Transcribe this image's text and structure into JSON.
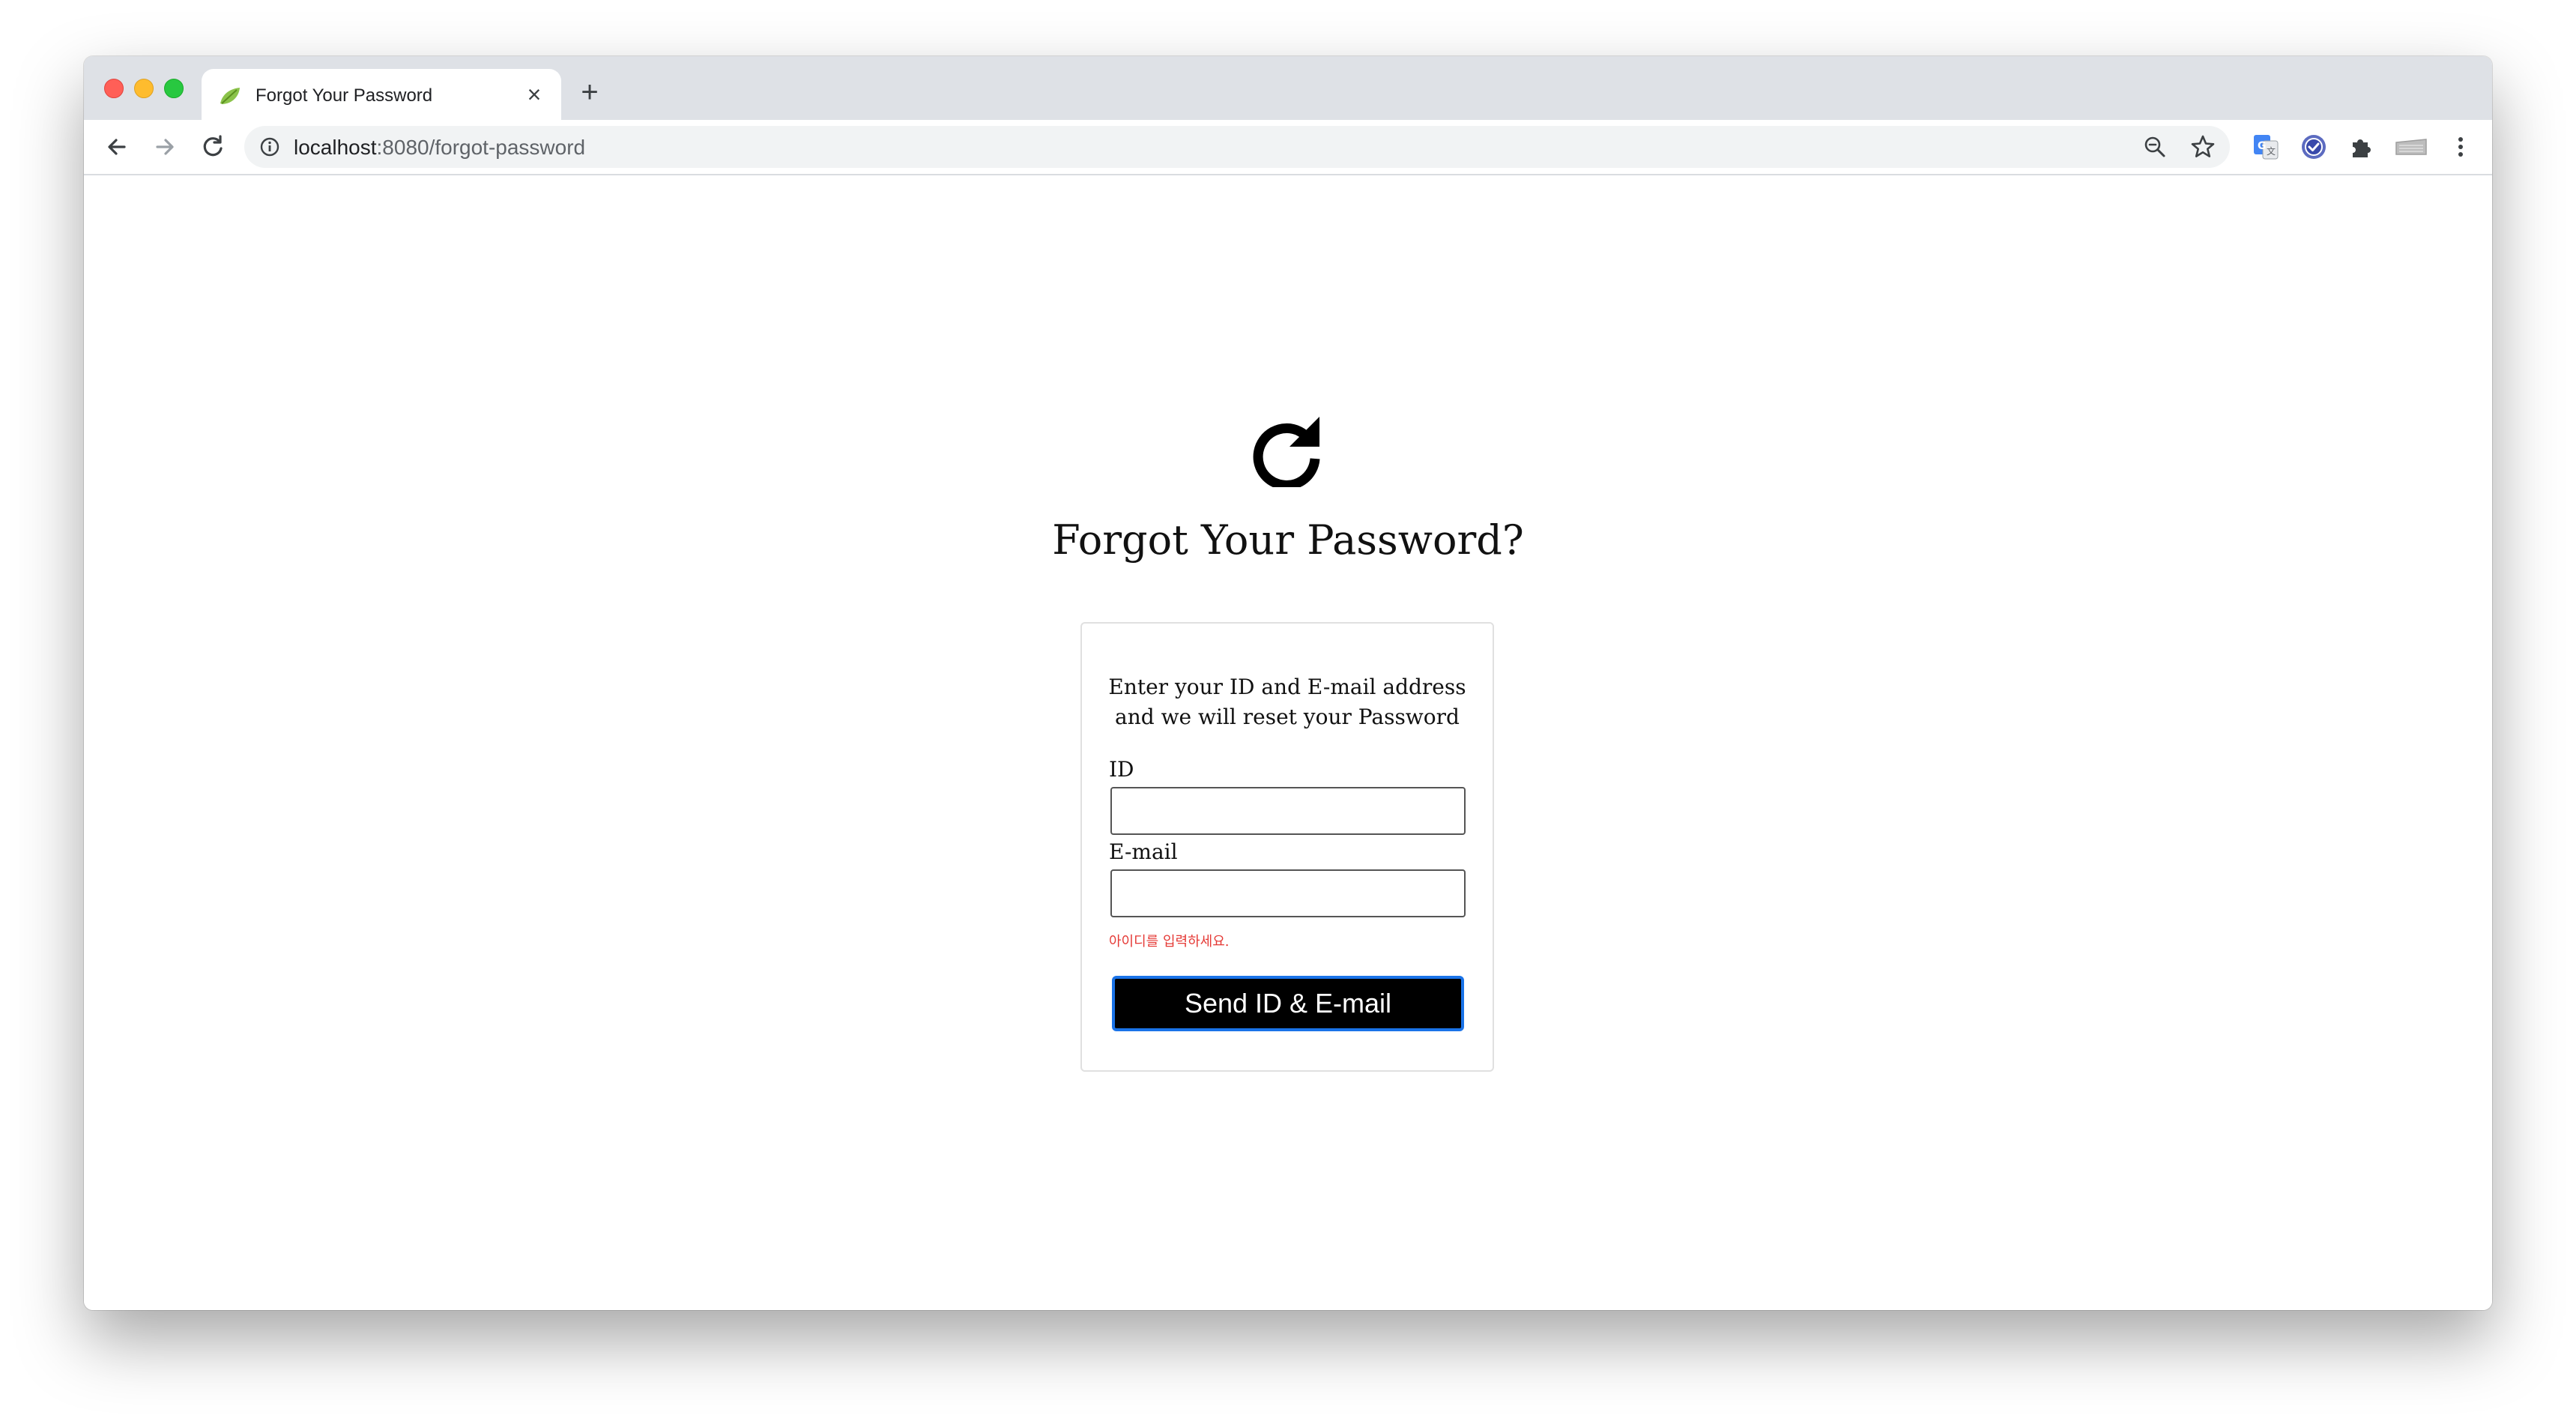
{
  "browser": {
    "tab_title": "Forgot Your Password",
    "tab_close": "×",
    "new_tab": "+",
    "url_host": "localhost",
    "url_path": ":8080/forgot-password"
  },
  "page": {
    "title": "Forgot Your Password?",
    "description_line1": "Enter your ID and E-mail address",
    "description_line2": "and we will reset your Password",
    "id_label": "ID",
    "email_label": "E-mail",
    "id_value": "",
    "email_value": "",
    "error_message": "아이디를 입력하세요.",
    "submit_label": "Send ID & E-mail"
  },
  "icons": {
    "back": "arrow-left-icon",
    "forward": "arrow-right-icon",
    "reload": "reload-icon",
    "site_info": "info-icon",
    "zoom": "zoom-out-icon",
    "bookmark": "star-icon",
    "translate": "google-translate-icon",
    "extension_check": "check-circle-icon",
    "extensions": "puzzle-icon",
    "profile": "keyboard-icon",
    "menu": "more-vert-icon",
    "page_icon": "refresh-icon"
  },
  "colors": {
    "error": "#e53935",
    "button_bg": "#000000",
    "button_border": "#1a73e8"
  }
}
